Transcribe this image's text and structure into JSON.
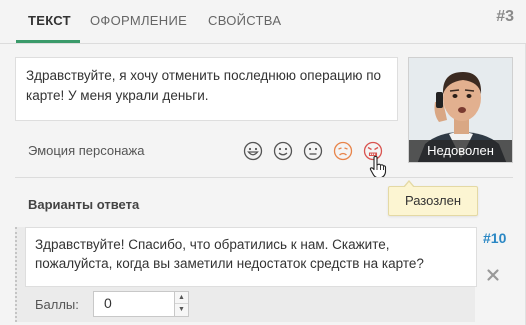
{
  "tabs": [
    {
      "label": "Текст",
      "active": true
    },
    {
      "label": "Оформление",
      "active": false
    },
    {
      "label": "Свойства",
      "active": false
    }
  ],
  "slide_number": "#3",
  "phrase": {
    "text": "Здравствуйте, я хочу отменить последнюю операцию по карте! У меня украли деньги."
  },
  "character": {
    "emotion_caption": "Недоволен"
  },
  "emotion": {
    "label": "Эмоция персонажа",
    "icons": [
      "happy-face-icon",
      "smile-face-icon",
      "neutral-face-icon",
      "sad-face-icon",
      "angry-face-icon"
    ],
    "hover_tooltip": "Разозлен"
  },
  "answers": {
    "title": "Варианты ответа",
    "items": [
      {
        "number": "#10",
        "text": "Здравствуйте! Спасибо, что обратились к нам. Скажите, пожалуйста, когда вы заметили недостаток средств на карте?",
        "score_label": "Баллы:",
        "score_value": "0"
      }
    ]
  },
  "colors": {
    "accent": "#3a9a6a",
    "link": "#2a87c4",
    "angry": "#d9534f",
    "sad": "#e8844a",
    "tooltip_bg": "#fcf5d2"
  }
}
